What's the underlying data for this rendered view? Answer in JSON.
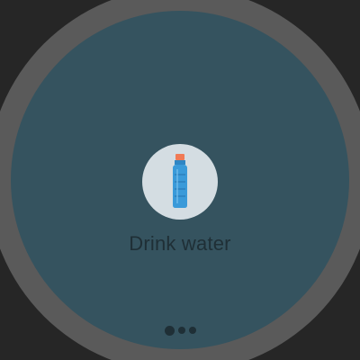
{
  "action": {
    "label": "Drink water",
    "icon": "water-bottle-icon"
  },
  "pager": {
    "total_pages": 3,
    "current_page": 1
  },
  "colors": {
    "screen_background": "#35535f",
    "bezel": "#5a5a5a",
    "icon_background": "#d4dde2",
    "bottle_body": "#3a9ad9",
    "bottle_cap": "#f07a55",
    "text": "#1f2f36"
  }
}
